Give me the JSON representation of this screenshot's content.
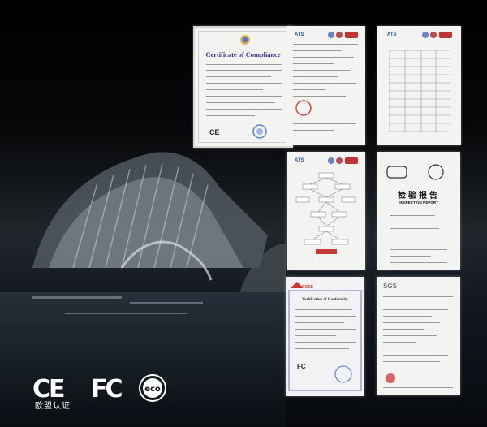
{
  "certificates": [
    {
      "id": "c1",
      "title": "Certificate of Compliance",
      "mark": "CE"
    },
    {
      "id": "c2",
      "brand": "ATS"
    },
    {
      "id": "c3",
      "brand": "ATS"
    },
    {
      "id": "c4",
      "brand": "ATS"
    },
    {
      "id": "c5",
      "title_cn": "检验报告",
      "title_en": "INSPECTION REPORT"
    },
    {
      "id": "c6",
      "brand": "POCE",
      "title": "Verification of Conformity",
      "mark": "FC"
    },
    {
      "id": "c7",
      "brand": "SGS"
    }
  ],
  "bottom_logos": {
    "ce": "CE",
    "ce_caption": "欧盟认证",
    "fcc": "FC",
    "eco": "eco"
  }
}
